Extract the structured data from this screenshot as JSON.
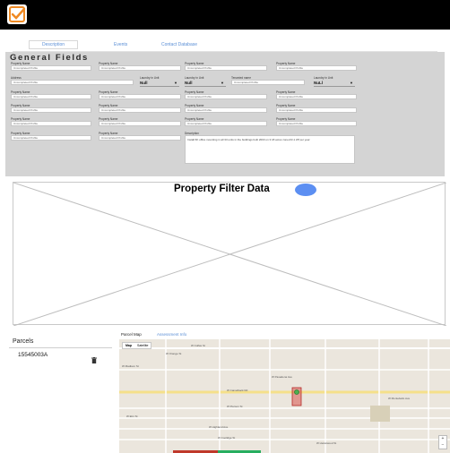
{
  "tabs": [
    {
      "label": "Description"
    },
    {
      "label": "Events"
    },
    {
      "label": "Contact Database"
    }
  ],
  "panel": {
    "title": "General Fields",
    "rows": [
      [
        {
          "label": "Property Name",
          "value": "Uncompleted Profile"
        },
        {
          "label": "Property Name",
          "value": "Uncompleted Profile"
        },
        {
          "label": "Property Name",
          "value": "Uncompleted Profile"
        },
        {
          "label": "Property Name",
          "value": "Uncompleted Profile"
        }
      ],
      [
        {
          "label": "Address",
          "value": "Uncompleted Profile"
        },
        {
          "label": "Laundry in Unit",
          "select": "Null"
        },
        {
          "label": "Laundry in Unit",
          "select": "Null"
        },
        {
          "label": "Tenanted name",
          "value": "Uncompleted Profile"
        },
        {
          "label": "Laundry in Unit",
          "select": "NuLl"
        }
      ],
      [
        {
          "label": "Property Name",
          "value": "Uncompleted Profile"
        },
        {
          "label": "Property Name",
          "value": "Uncompleted Profile"
        },
        {
          "label": "Property Name",
          "value": "Uncompleted Profile"
        },
        {
          "label": "Property Name",
          "value": "Uncompleted Profile"
        }
      ],
      [
        {
          "label": "Property Name",
          "value": "Uncompleted Profile"
        },
        {
          "label": "Property Name",
          "value": "Uncompleted Profile"
        },
        {
          "label": "Property Name",
          "value": "Uncompleted Profile"
        },
        {
          "label": "Property Name",
          "value": "Uncompleted Profile"
        }
      ],
      [
        {
          "label": "Property Name",
          "value": "Uncompleted Profile"
        },
        {
          "label": "Property Name",
          "value": "Uncompleted Profile"
        },
        {
          "label": "Property Name",
          "value": "Uncompleted Profile"
        },
        {
          "label": "Property Name",
          "value": "Uncompleted Profile"
        }
      ],
      [
        {
          "label": "Property Name",
          "value": "Uncompleted Profile"
        },
        {
          "label": "Property Name",
          "value": "Uncompleted Profile"
        },
        {
          "label": "Description",
          "text": "Install 6K office mounting in all 33 units in the buildings built 2003 on 3 18 acres zoned R-1 ZP per year"
        }
      ]
    ]
  },
  "filter": {
    "title": "Property Filter Data"
  },
  "parcels": {
    "title": "Parcels",
    "items": [
      {
        "number": "15545003A"
      }
    ]
  },
  "map_tabs": [
    {
      "label": "Parcel Map"
    },
    {
      "label": "Assessment Info"
    }
  ],
  "map": {
    "toggle": [
      "Map",
      "Satellite"
    ],
    "labels": [
      {
        "text": "W Orange St"
      },
      {
        "text": "W Madison St"
      },
      {
        "text": "W Colfax St"
      },
      {
        "text": "W Camelback Rd"
      },
      {
        "text": "W Pierson St"
      },
      {
        "text": "W Elm St"
      },
      {
        "text": "W Highland Ave"
      },
      {
        "text": "W Coolidge St"
      },
      {
        "text": "W Hazelwood St"
      },
      {
        "text": "W Pasadena Ave"
      },
      {
        "text": "W Montebello Ave"
      }
    ]
  },
  "colors": {
    "accent": "#5c8ff2",
    "tab_text": "#5b8fd6",
    "panel_bg": "#d4d4d4",
    "selected_parcel": "#d9534f"
  }
}
